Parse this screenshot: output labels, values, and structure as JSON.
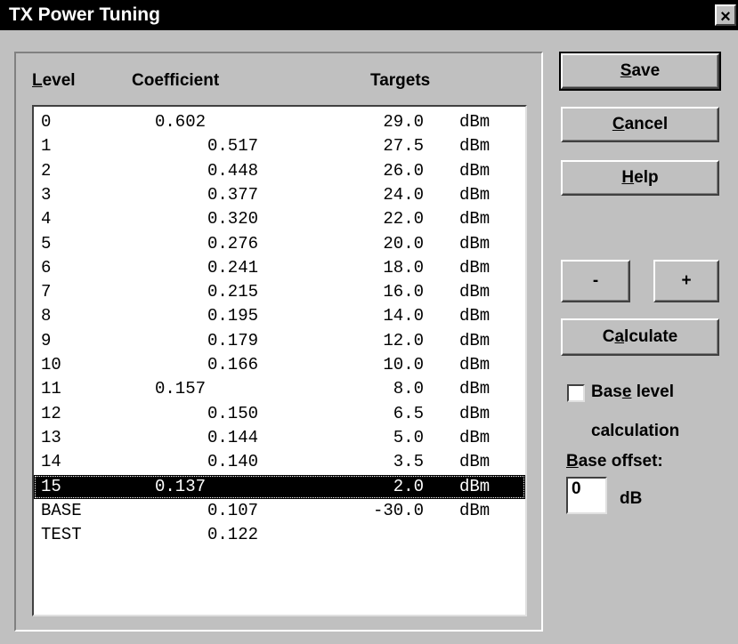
{
  "window": {
    "title": "TX Power Tuning",
    "close_glyph": "×"
  },
  "table": {
    "headers": {
      "level_mnemonic": "L",
      "level_rest": "evel",
      "coefficient": "Coefficient",
      "targets": "Targets"
    },
    "rows": [
      {
        "level": "0",
        "coefficient": "0.602",
        "target": "29.0",
        "unit": "dBm",
        "indent": "short"
      },
      {
        "level": "1",
        "coefficient": "0.517",
        "target": "27.5",
        "unit": "dBm",
        "indent": "long"
      },
      {
        "level": "2",
        "coefficient": "0.448",
        "target": "26.0",
        "unit": "dBm",
        "indent": "long"
      },
      {
        "level": "3",
        "coefficient": "0.377",
        "target": "24.0",
        "unit": "dBm",
        "indent": "long"
      },
      {
        "level": "4",
        "coefficient": "0.320",
        "target": "22.0",
        "unit": "dBm",
        "indent": "long"
      },
      {
        "level": "5",
        "coefficient": "0.276",
        "target": "20.0",
        "unit": "dBm",
        "indent": "long"
      },
      {
        "level": "6",
        "coefficient": "0.241",
        "target": "18.0",
        "unit": "dBm",
        "indent": "long"
      },
      {
        "level": "7",
        "coefficient": "0.215",
        "target": "16.0",
        "unit": "dBm",
        "indent": "long"
      },
      {
        "level": "8",
        "coefficient": "0.195",
        "target": "14.0",
        "unit": "dBm",
        "indent": "long"
      },
      {
        "level": "9",
        "coefficient": "0.179",
        "target": "12.0",
        "unit": "dBm",
        "indent": "long"
      },
      {
        "level": "10",
        "coefficient": "0.166",
        "target": "10.0",
        "unit": "dBm",
        "indent": "long"
      },
      {
        "level": "11",
        "coefficient": "0.157",
        "target": "8.0",
        "unit": "dBm",
        "indent": "short"
      },
      {
        "level": "12",
        "coefficient": "0.150",
        "target": "6.5",
        "unit": "dBm",
        "indent": "long"
      },
      {
        "level": "13",
        "coefficient": "0.144",
        "target": "5.0",
        "unit": "dBm",
        "indent": "long"
      },
      {
        "level": "14",
        "coefficient": "0.140",
        "target": "3.5",
        "unit": "dBm",
        "indent": "long"
      },
      {
        "level": "15",
        "coefficient": "0.137",
        "target": "2.0",
        "unit": "dBm",
        "indent": "short",
        "selected": true
      },
      {
        "level": "BASE",
        "coefficient": "0.107",
        "target": "-30.0",
        "unit": "dBm",
        "indent": "long"
      },
      {
        "level": "TEST",
        "coefficient": "0.122",
        "target": "",
        "unit": "",
        "indent": "long"
      }
    ]
  },
  "buttons": {
    "save": {
      "mnemonic": "S",
      "rest": "ave"
    },
    "cancel": {
      "mnemonic": "C",
      "rest": "ancel"
    },
    "help": {
      "mnemonic": "H",
      "rest": "elp"
    },
    "minus": "-",
    "plus": "+",
    "calculate": {
      "pre": "C",
      "mnemonic": "a",
      "rest": "lculate"
    }
  },
  "base_level": {
    "checked": false,
    "label_pre": "Bas",
    "label_mnemonic": "e",
    "label_rest": " level",
    "label_line2": "calculation"
  },
  "base_offset": {
    "label_mnemonic": "B",
    "label_rest": "ase offset:",
    "value": "0",
    "unit": "dB"
  }
}
